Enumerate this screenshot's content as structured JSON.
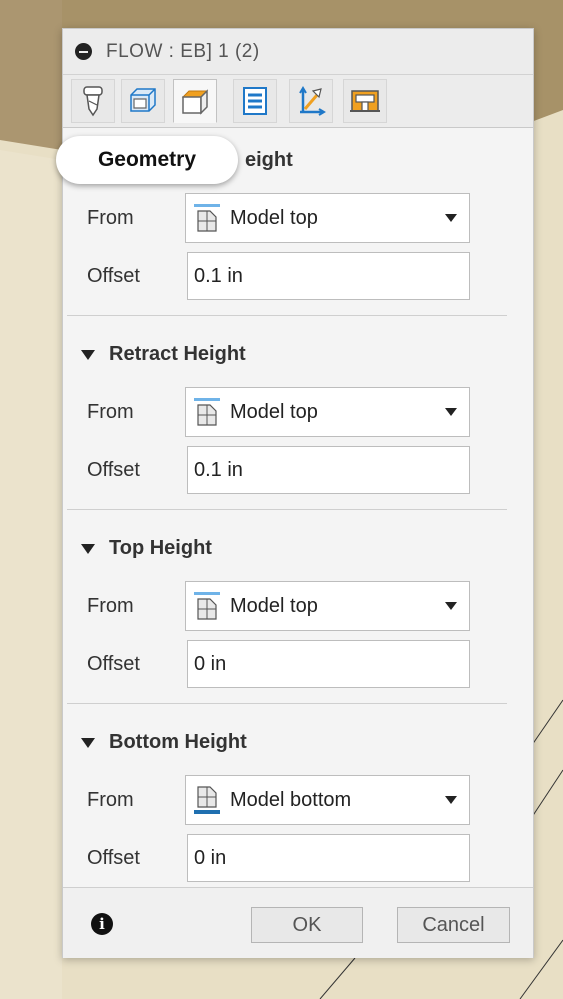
{
  "window": {
    "title": "FLOW : EB] 1 (2)"
  },
  "tabs": [
    {
      "name": "tool",
      "icon": "tool-icon"
    },
    {
      "name": "geometry",
      "icon": "geometry-icon"
    },
    {
      "name": "heights",
      "icon": "heights-icon",
      "active": true
    },
    {
      "name": "passes",
      "icon": "passes-icon"
    },
    {
      "name": "linking",
      "icon": "linking-icon"
    },
    {
      "name": "shop",
      "icon": "shop-icon"
    }
  ],
  "tooltip": {
    "text": "Geometry"
  },
  "sections": {
    "clearance": {
      "title_fragment": "eight",
      "from_label": "From",
      "from_value": "Model top",
      "offset_label": "Offset",
      "offset_value": "0.1 in"
    },
    "retract": {
      "title": "Retract Height",
      "from_label": "From",
      "from_value": "Model top",
      "offset_label": "Offset",
      "offset_value": "0.1 in"
    },
    "top": {
      "title": "Top Height",
      "from_label": "From",
      "from_value": "Model top",
      "offset_label": "Offset",
      "offset_value": "0 in"
    },
    "bottom": {
      "title": "Bottom Height",
      "from_label": "From",
      "from_value": "Model bottom",
      "offset_label": "Offset",
      "offset_value": "0 in"
    }
  },
  "footer": {
    "ok_label": "OK",
    "cancel_label": "Cancel"
  },
  "colors": {
    "accent_blue": "#1f78c8",
    "orange": "#f0a020",
    "dialog_bg": "#f4f4f4"
  }
}
